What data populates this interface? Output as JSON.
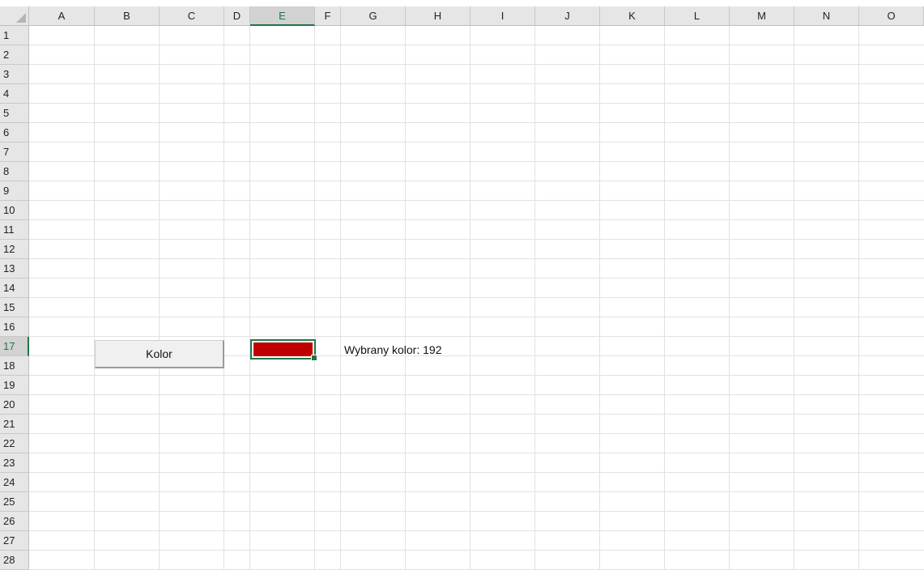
{
  "sheet": {
    "columns": [
      "A",
      "B",
      "C",
      "D",
      "E",
      "F",
      "G",
      "H",
      "I",
      "J",
      "K",
      "L",
      "M",
      "N",
      "O"
    ],
    "rows": [
      "1",
      "2",
      "3",
      "4",
      "5",
      "6",
      "7",
      "8",
      "9",
      "10",
      "11",
      "12",
      "13",
      "14",
      "15",
      "16",
      "17",
      "18",
      "19",
      "20",
      "21",
      "22",
      "23",
      "24",
      "25",
      "26",
      "27",
      "28"
    ],
    "selected_column": "E",
    "selected_row": "17",
    "grid_color": "#e1e1e1",
    "header_bg": "#e6e6e6",
    "selection_color": "#217346"
  },
  "button": {
    "label": "Kolor"
  },
  "selected_cell": {
    "fill_color": "#c00000"
  },
  "result": {
    "text": "Wybrany kolor: 192"
  }
}
